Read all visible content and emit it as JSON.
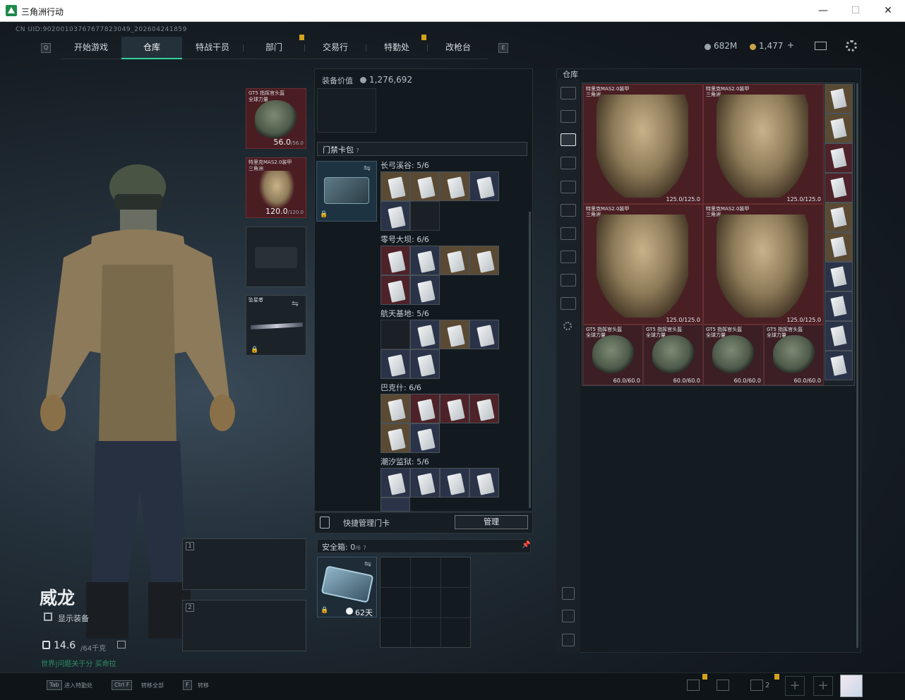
{
  "window": {
    "title": "三角洲行动",
    "minimize": "—",
    "maximize": "☐",
    "close": "✕"
  },
  "uid": "CN UID:90200103767677823049_2026042418​59",
  "nav": {
    "tabs": [
      {
        "label": "开始游戏"
      },
      {
        "label": "仓库"
      },
      {
        "label": "特战干员"
      },
      {
        "label": "部门"
      },
      {
        "label": "交易行"
      },
      {
        "label": "特勤处"
      },
      {
        "label": "改枪台"
      }
    ],
    "left_key": "Q",
    "right_key": "E"
  },
  "currency": {
    "hafcoin": "682M",
    "bonds": "1,477",
    "plus": "+"
  },
  "character": {
    "name": "威龙",
    "show_equipment": "显示装备",
    "weight": "14.6",
    "weight_max": "/64千克",
    "hint": "世界|问题关于分 买命拉"
  },
  "equip": {
    "helmet": {
      "name": "GT5 指挥官头盔",
      "sub": "全球力量",
      "value": "56.0",
      "max": "/56.0"
    },
    "armor": {
      "name": "特里克MAS2.0装甲",
      "sub": "三角洲",
      "value": "120.0",
      "max": "/120.0"
    },
    "melee": {
      "name": "坠星者"
    },
    "slot1": "1",
    "slot2": "2"
  },
  "middle": {
    "equip_value_label": "装备价值",
    "equip_value": "1,276,692",
    "keybag_title": "门禁卡包",
    "keybag_help": "?",
    "groups": [
      {
        "title": "长弓溪谷: 5/6"
      },
      {
        "title": "零号大坝: 6/6"
      },
      {
        "title": "航天基地: 5/6"
      },
      {
        "title": "巴克什: 6/6"
      },
      {
        "title": "潮汐监狱: 5/6"
      }
    ],
    "quick_manage": "快捷管理门卡",
    "manage": "管理",
    "safebox_title": "安全箱:",
    "safebox_count": "0",
    "safebox_max": "/6",
    "safebox_help": "?",
    "safebox_days": "62天"
  },
  "warehouse": {
    "title": "仓库",
    "armors": [
      {
        "name": "特里克MAS2.0装甲",
        "sub": "三角洲",
        "value": "125.0/125.0"
      },
      {
        "name": "特里克MAS2.0装甲",
        "sub": "三角洲",
        "value": "125.0/125.0"
      },
      {
        "name": "特里克MAS2.0装甲",
        "sub": "三角洲",
        "value": "125.0/125.0"
      },
      {
        "name": "特里克MAS2.0装甲",
        "sub": "三角洲",
        "value": "125.0/125.0"
      }
    ],
    "helmets": [
      {
        "name": "GT5 指挥官头盔",
        "sub": "全球力量",
        "value": "60.0/60.0"
      },
      {
        "name": "GT5 指挥官头盔",
        "sub": "全球力量",
        "value": "60.0/60.0"
      },
      {
        "name": "GT5 指挥官头盔",
        "sub": "全球力量",
        "value": "60.0/60.0"
      },
      {
        "name": "GT5 指挥官头盔",
        "sub": "全球力量",
        "value": "60.0/60.0"
      }
    ]
  },
  "bottom": {
    "hint1_key": "Tab",
    "hint1": "进入特勤处",
    "hint2_key": "Ctrl F",
    "hint2": "转移全部",
    "hint3_key": "F",
    "hint3": "转移",
    "team_count": "2"
  }
}
